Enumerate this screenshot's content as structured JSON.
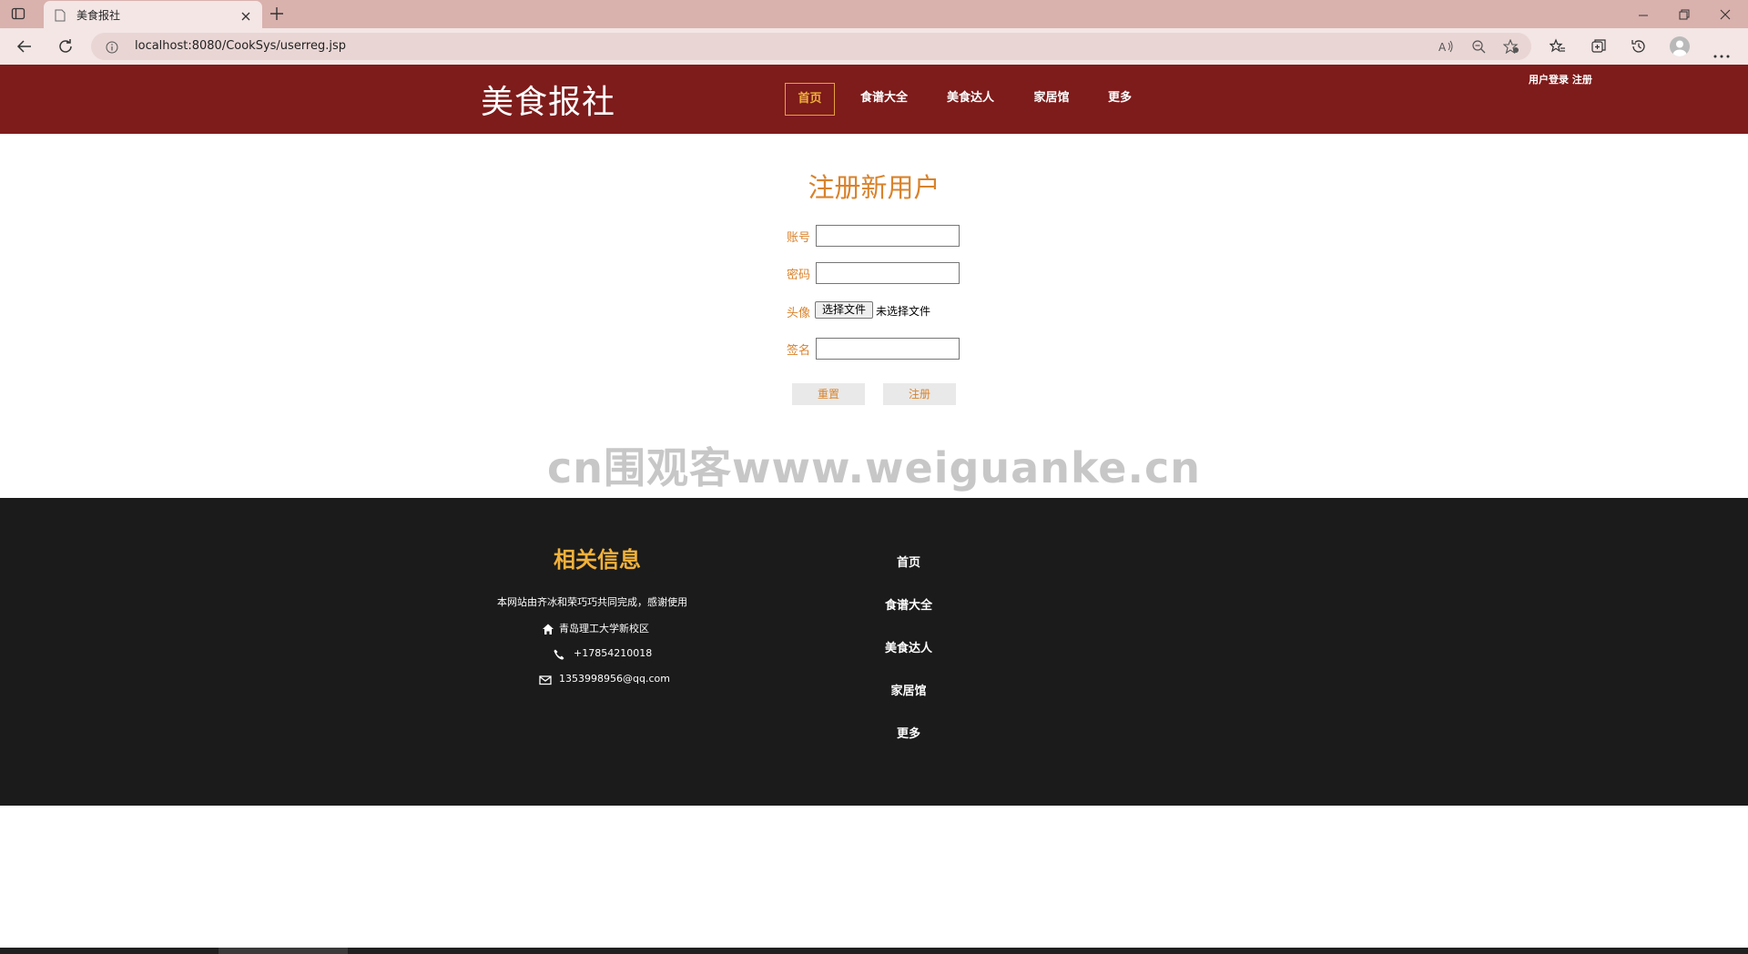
{
  "browser": {
    "tab_title": "美食报社",
    "url": "localhost:8080/CookSys/userreg.jsp"
  },
  "header": {
    "logo": "美食报社",
    "nav": [
      {
        "label": "首页",
        "active": true
      },
      {
        "label": "食谱大全",
        "active": false
      },
      {
        "label": "美食达人",
        "active": false
      },
      {
        "label": "家居馆",
        "active": false
      },
      {
        "label": "更多",
        "active": false
      }
    ],
    "login_links": "用户登录 注册"
  },
  "form": {
    "title": "注册新用户",
    "account_label": "账号",
    "account_value": "",
    "password_label": "密码",
    "password_value": "",
    "avatar_label": "头像",
    "file_button": "选择文件",
    "file_status": "未选择文件",
    "signature_label": "签名",
    "signature_value": "",
    "reset_button": "重置",
    "submit_button": "注册"
  },
  "watermark": "cn围观客www.weiguanke.cn",
  "footer": {
    "heading": "相关信息",
    "description": "本网站由齐冰和荣巧巧共同完成，感谢使用",
    "address": "青岛理工大学新校区",
    "phone": "+17854210018",
    "email": "1353998956@qq.com",
    "links": [
      "首页",
      "食谱大全",
      "美食达人",
      "家居馆",
      "更多"
    ]
  },
  "colors": {
    "header_bg": "#7e1b1b",
    "accent": "#d9822b",
    "footer_bg": "#1b1b1b",
    "footer_heading": "#f0b13c"
  }
}
